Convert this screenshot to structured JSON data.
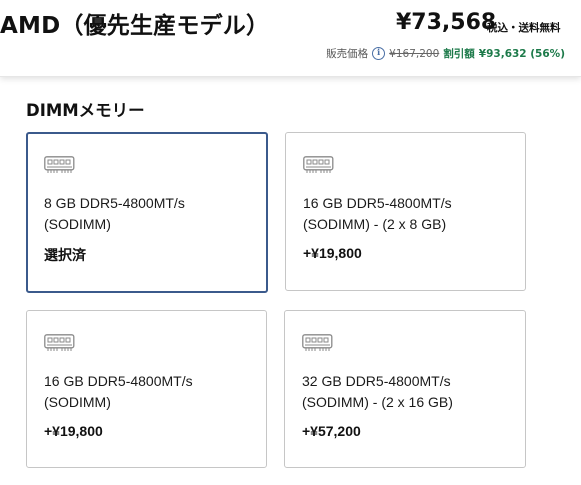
{
  "header": {
    "product_title": "AMD（優先生産モデル）",
    "price": "¥73,568",
    "price_note": "税込・送料無料",
    "sale_price_label": "販売価格",
    "original_price": "¥167,200",
    "discount_label": "割引額",
    "discount_value": "¥93,632 (56%)"
  },
  "section": {
    "title": "DIMMメモリー"
  },
  "options": [
    {
      "line1": "8 GB DDR5-4800MT/s",
      "line2": "(SODIMM)",
      "status": "選択済",
      "selected": true
    },
    {
      "line1": "16 GB DDR5-4800MT/s",
      "line2": "(SODIMM) - (2 x 8 GB)",
      "status": "+¥19,800",
      "selected": false
    },
    {
      "line1": "16 GB DDR5-4800MT/s",
      "line2": "(SODIMM)",
      "status": "+¥19,800",
      "selected": false
    },
    {
      "line1": "32 GB DDR5-4800MT/s",
      "line2": "(SODIMM) - (2 x 16 GB)",
      "status": "+¥57,200",
      "selected": false
    }
  ],
  "icons": {
    "info": "info-icon",
    "memory": "memory-module-icon"
  },
  "colors": {
    "selected_border": "#3b5a8c",
    "discount": "#1d7a4a"
  }
}
